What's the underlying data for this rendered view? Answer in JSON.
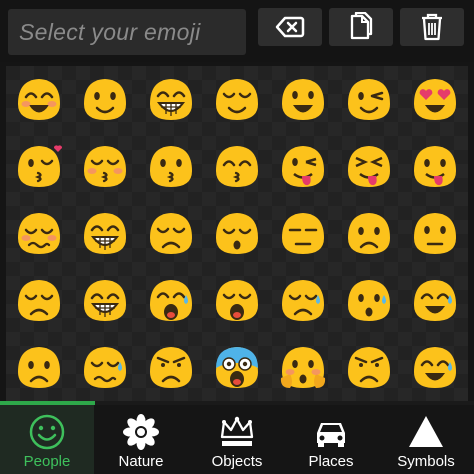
{
  "search": {
    "placeholder": "Select your emoji"
  },
  "toolbar": {
    "delete_icon": "backspace-icon",
    "copy_icon": "copy-icon",
    "trash_icon": "trash-icon"
  },
  "colors": {
    "accent": "#3ec05c",
    "emoji_yellow": "#fcc21b",
    "progress": "#2ea84a"
  },
  "scroll_progress_percent": 20,
  "emojis": [
    "laughing-blush",
    "smile",
    "grin-teeth",
    "content-smile",
    "happy-smile",
    "wink",
    "heart-eyes",
    "kiss-heart",
    "kiss-blush",
    "kiss-closed",
    "kiss-smile",
    "tongue-wink",
    "tongue-closed",
    "tongue-out",
    "flushed-smile",
    "big-grin",
    "relieved",
    "sleepy-open",
    "unamused",
    "sad-frown",
    "neutral-flat",
    "disappointed",
    "laugh-closed",
    "crying-loud",
    "weary",
    "sweat-sad",
    "sweat-worried",
    "sweat-smile",
    "frowning",
    "crying-tear",
    "angry",
    "fearful-scream",
    "clutched-face",
    "angry-red",
    "sweat-grin"
  ],
  "categories": [
    {
      "label": "People",
      "icon": "smiley-icon",
      "active": true
    },
    {
      "label": "Nature",
      "icon": "flower-icon",
      "active": false
    },
    {
      "label": "Objects",
      "icon": "crown-icon",
      "active": false
    },
    {
      "label": "Places",
      "icon": "car-icon",
      "active": false
    },
    {
      "label": "Symbols",
      "icon": "triangle-icon",
      "active": false
    }
  ]
}
